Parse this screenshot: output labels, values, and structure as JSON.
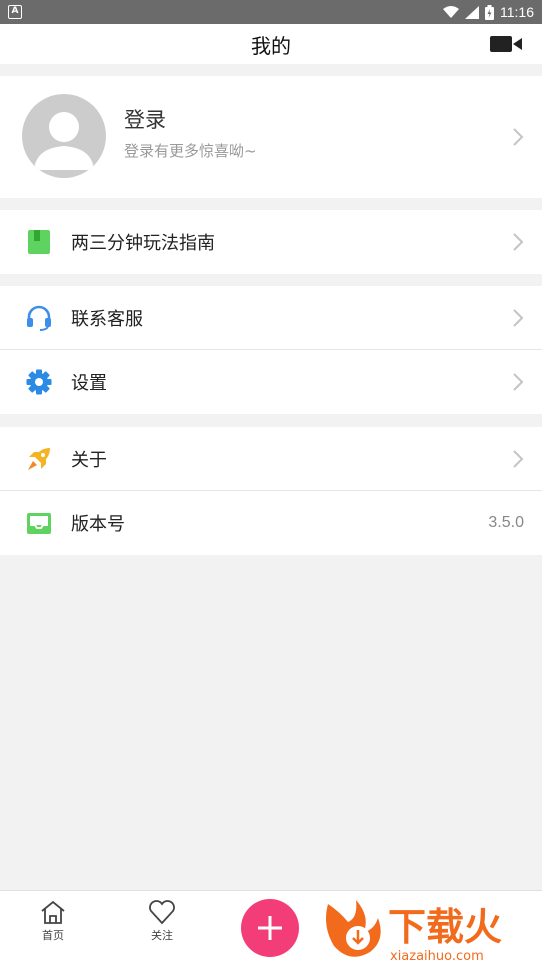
{
  "statusbar": {
    "time": "11:16"
  },
  "header": {
    "title": "我的"
  },
  "profile": {
    "title": "登录",
    "subtitle": "登录有更多惊喜呦~"
  },
  "groups": [
    [
      {
        "label": "两三分钟玩法指南",
        "icon": "book-icon",
        "color": "#4cd964"
      }
    ],
    [
      {
        "label": "联系客服",
        "icon": "headset-icon",
        "color": "#3b8fe8"
      },
      {
        "label": "设置",
        "icon": "gear-icon",
        "color": "#2b8ae6"
      }
    ],
    [
      {
        "label": "关于",
        "icon": "rocket-icon",
        "color": "#f5b324"
      },
      {
        "label": "版本号",
        "icon": "inbox-icon",
        "color": "#4cd964",
        "value": "3.5.0"
      }
    ]
  ],
  "tabbar": {
    "home_label": "首页",
    "follow_label": "关注"
  },
  "watermark": {
    "text": "下载火",
    "url": "xiazaihuo.com"
  }
}
